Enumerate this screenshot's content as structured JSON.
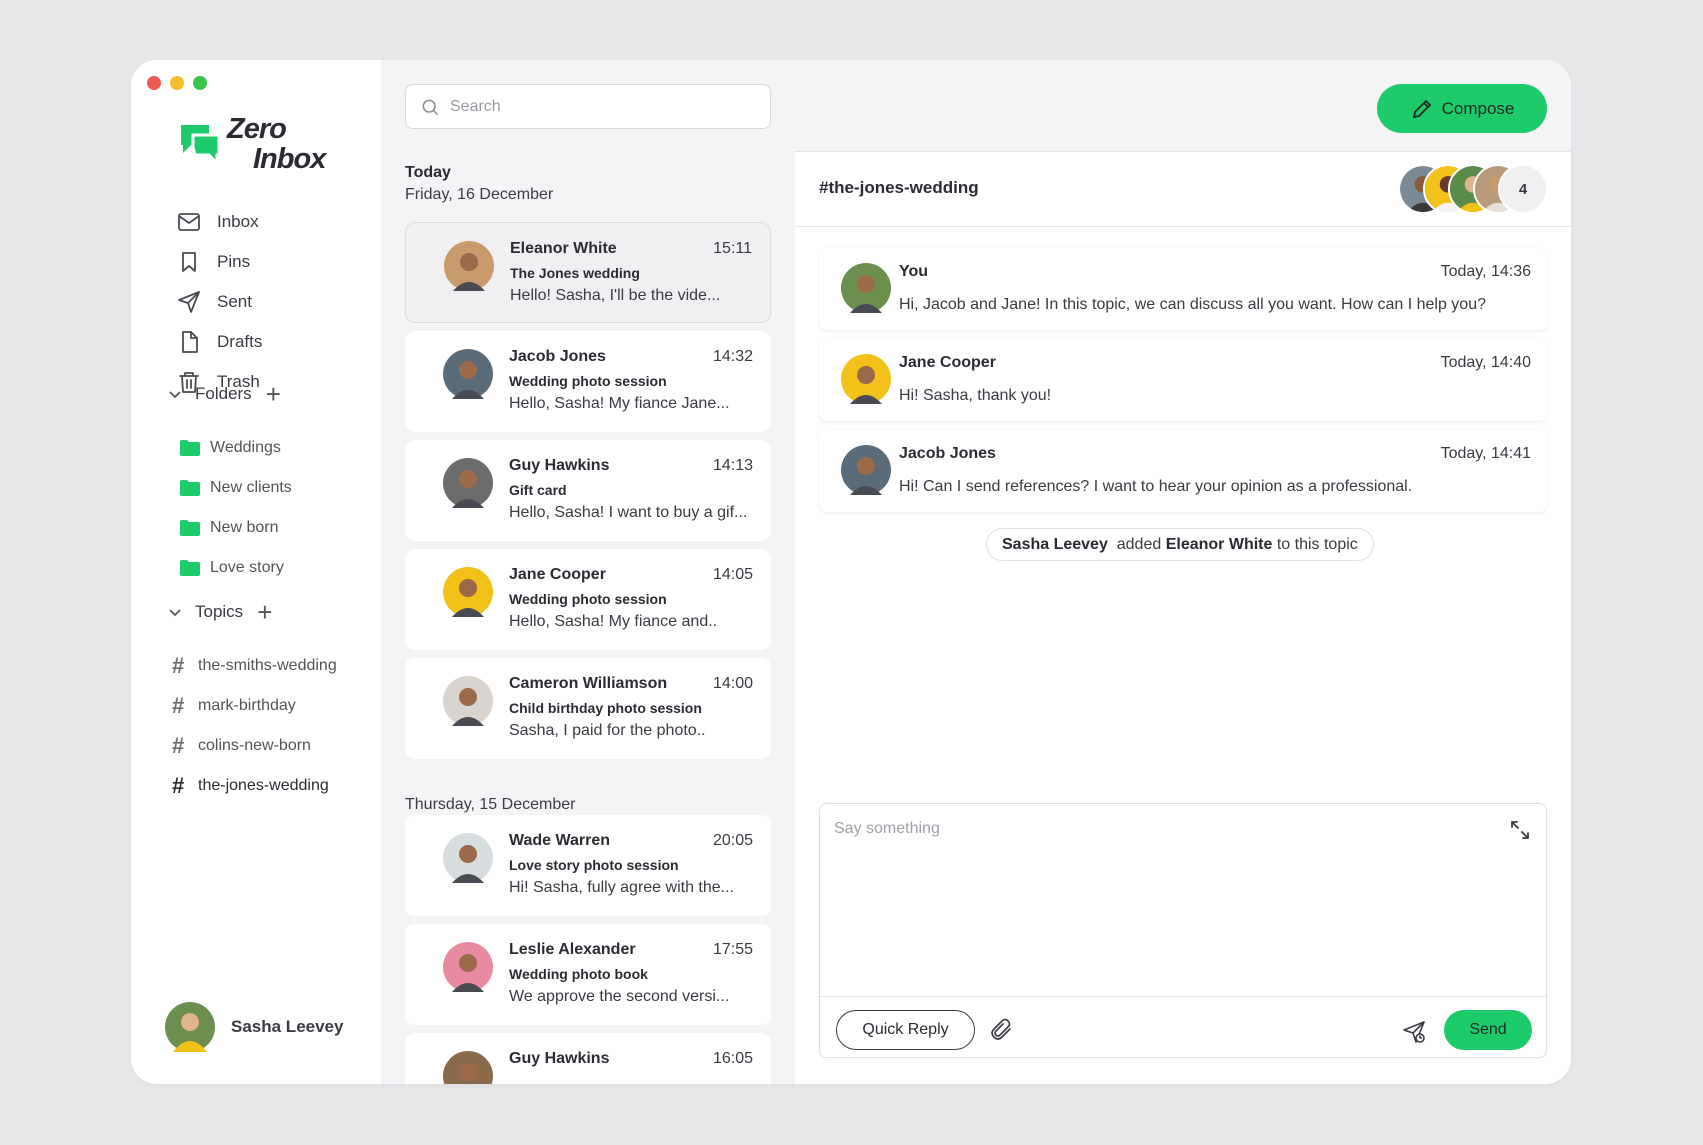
{
  "app": {
    "logo_line1": "Zero",
    "logo_line2": "Inbox",
    "traffic_colors": [
      "#ee5a52",
      "#f4bd2e",
      "#3ac449"
    ],
    "accent": "#1ecb6b"
  },
  "sidebar": {
    "nav": [
      {
        "label": "Inbox",
        "icon": "mail-icon"
      },
      {
        "label": "Pins",
        "icon": "bookmark-icon"
      },
      {
        "label": "Sent",
        "icon": "send-icon"
      },
      {
        "label": "Drafts",
        "icon": "file-icon"
      },
      {
        "label": "Trash",
        "icon": "trash-icon"
      }
    ],
    "folders_label": "Folders",
    "folders": [
      "Weddings",
      "New clients",
      "New born",
      "Love story"
    ],
    "topics_label": "Topics",
    "topics": [
      "the-smiths-wedding",
      "mark-birthday",
      "colins-new-born",
      "the-jones-wedding"
    ],
    "active_topic": "the-jones-wedding",
    "profile_name": "Sasha Leevey"
  },
  "search": {
    "placeholder": "Search"
  },
  "messages": {
    "today_label": "Today",
    "today_date": "Friday, 16 December",
    "yesterday_date": "Thursday, 15 December",
    "items": [
      {
        "name": "Eleanor White",
        "time": "15:11",
        "subject": "The Jones wedding",
        "preview": "Hello! Sasha, I'll be the vide...",
        "avatar_color": "#c89a6e"
      },
      {
        "name": "Jacob Jones",
        "time": "14:32",
        "subject": "Wedding photo session",
        "preview": "Hello, Sasha! My fiance Jane...",
        "avatar_color": "#5a6b7a"
      },
      {
        "name": "Guy Hawkins",
        "time": "14:13",
        "subject": "Gift card",
        "preview": "Hello, Sasha! I want to buy a gif...",
        "avatar_color": "#6b6b6b"
      },
      {
        "name": "Jane Cooper",
        "time": "14:05",
        "subject": "Wedding  photo session",
        "preview": "Hello, Sasha! My fiance and..",
        "avatar_color": "#f2c21b"
      },
      {
        "name": "Cameron Williamson",
        "time": "14:00",
        "subject": "Child birthday photo session",
        "preview": "Sasha, I paid for the photo..",
        "avatar_color": "#d9d4cf"
      },
      {
        "name": "Wade Warren",
        "time": "20:05",
        "subject": "Love story  photo session",
        "preview": "Hi! Sasha, fully agree with the...",
        "avatar_color": "#d8dde0"
      },
      {
        "name": "Leslie Alexander",
        "time": "17:55",
        "subject": "Wedding  photo book",
        "preview": "We approve the second versi...",
        "avatar_color": "#e98ba0"
      },
      {
        "name": "Guy Hawkins",
        "time": "16:05",
        "subject": "",
        "preview": "",
        "avatar_color": "#8a6a4a"
      }
    ]
  },
  "compose_label": "Compose",
  "topic": {
    "title": "#the-jones-wedding",
    "member_count": "4",
    "member_colors": [
      "#7a8a96",
      "#f2c21b",
      "#5c8a4a",
      "#b89a7a"
    ]
  },
  "chat": [
    {
      "name": "You",
      "time": "Today, 14:36",
      "text": "Hi, Jacob and Jane! In this topic, we can discuss all you want. How can I help you?",
      "avatar_color": "#6b8f4e"
    },
    {
      "name": "Jane Cooper",
      "time": "Today, 14:40",
      "text": "Hi! Sasha, thank you!",
      "avatar_color": "#f2c21b"
    },
    {
      "name": "Jacob Jones",
      "time": "Today, 14:41",
      "text": "Hi! Can I send references? I want to hear your opinion as a professional.",
      "avatar_color": "#5a6b7a"
    }
  ],
  "system_note": {
    "actor": "Sasha Leevey",
    "verb": "added",
    "target": "Eleanor White",
    "suffix": "to this topic"
  },
  "composer": {
    "placeholder": "Say something",
    "quick_reply_label": "Quick Reply",
    "send_label": "Send"
  }
}
